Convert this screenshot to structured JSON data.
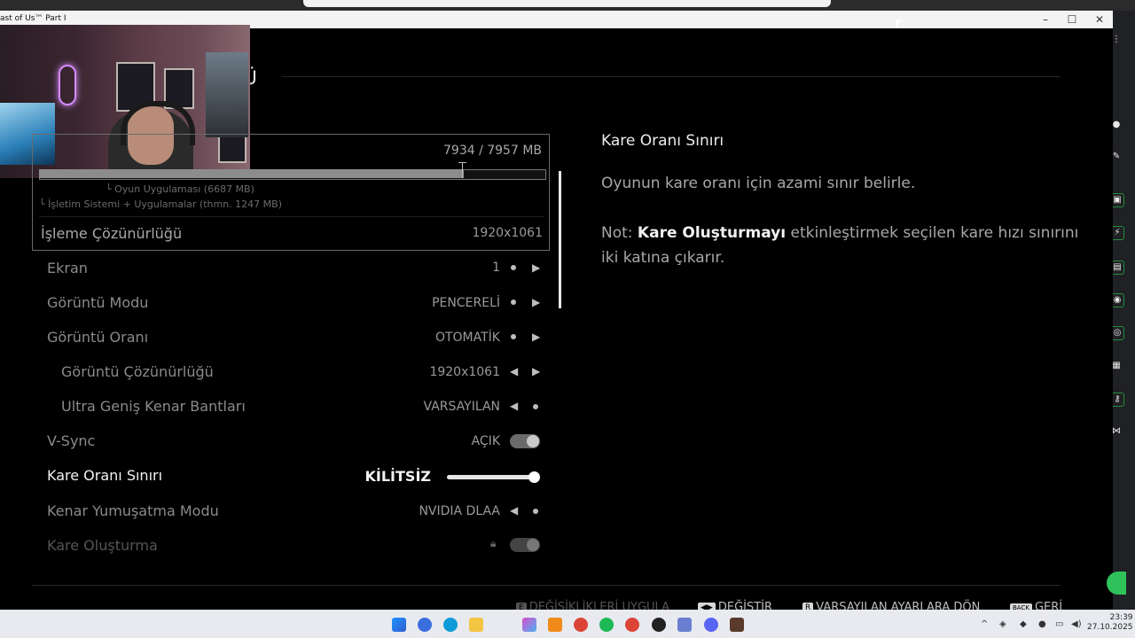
{
  "window": {
    "title": "ast of Us™ Part I"
  },
  "screen": {
    "heading": "NTÜ"
  },
  "vram": {
    "usage": "7934 / 7957 MB",
    "fill": 0.84,
    "game_apps": "└ Oyun Uygulaması (6687 MB)",
    "os_apps": "└ İşletim Sistemi + Uygulamalar (thmn. 1247 MB)"
  },
  "settings": {
    "render_res_label": "İşleme Çözünürlüğü",
    "render_res_value": "1920x1061",
    "display_label": "Ekran",
    "display_value": "1",
    "display_mode_label": "Görüntü Modu",
    "display_mode_value": "PENCERELİ",
    "aspect_label": "Görüntü Oranı",
    "aspect_value": "OTOMATİK",
    "resolution_label": "Görüntü Çözünürlüğü",
    "resolution_value": "1920x1061",
    "ultrawide_label": "Ultra Geniş Kenar Bantları",
    "ultrawide_value": "VARSAYILAN",
    "vsync_label": "V-Sync",
    "vsync_value": "AÇIK",
    "framerate_label": "Kare Oranı Sınırı",
    "framerate_value": "KİLİTSİZ",
    "framerate_slider": 1.0,
    "aa_label": "Kenar Yumuşatma Modu",
    "aa_value": "NVIDIA DLAA",
    "framegen_label": "Kare Oluşturma"
  },
  "description": {
    "title": "Kare Oranı Sınırı",
    "body": "Oyunun kare oranı için azami sınır belirle.",
    "note_prefix": "Not: ",
    "note_bold": "Kare Oluşturmayı",
    "note_rest": " etkinleştirmek seçilen kare hızı sınırını iki katına çıkarır."
  },
  "footer": {
    "apply_key": "E",
    "apply_label": "DEĞİŞİKLİKLERİ UYGULA",
    "change_label": "DEĞİŞTİR",
    "reset_key": "R",
    "reset_label": "VARSAYILAN AYARLARA DÖN",
    "back_key": "BACK",
    "back_label": "GERİ"
  },
  "taskbar": {
    "time": "23:39",
    "date": "27.10.2025"
  },
  "colors": {
    "background": "#000000",
    "accent_text": "#ececec",
    "muted_text": "#8a8a8a"
  }
}
